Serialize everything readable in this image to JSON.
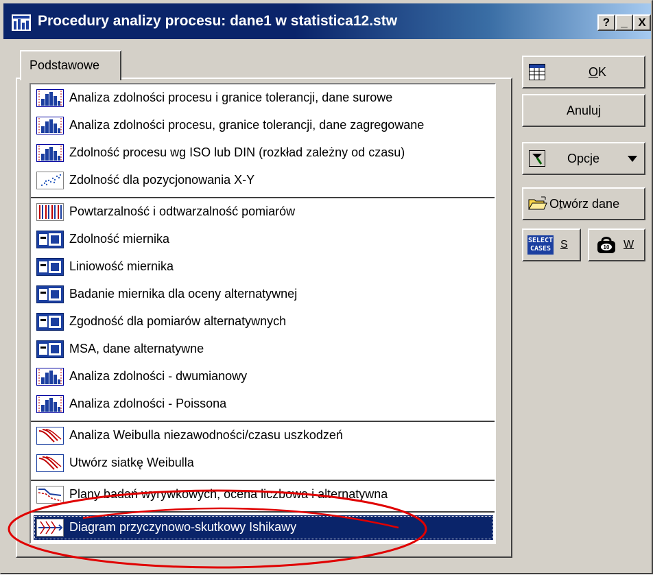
{
  "window": {
    "title": "Procedury analizy procesu: dane1 w statistica12.stw",
    "caption_buttons": [
      "?",
      "_",
      "X"
    ]
  },
  "tabs": [
    {
      "label": "Podstawowe",
      "active": true
    }
  ],
  "list": {
    "items": [
      {
        "label": "Analiza zdolności procesu i granice tolerancji, dane surowe",
        "icon": "capability-histogram-icon"
      },
      {
        "label": "Analiza zdolności procesu, granice tolerancji, dane zagregowane",
        "icon": "capability-histogram-icon"
      },
      {
        "label": "Zdolność procesu wg ISO lub DIN (rozkład zależny od czasu)",
        "icon": "capability-histogram-icon"
      },
      {
        "label": "Zdolność dla pozycjonowania X-Y",
        "icon": "scatter-icon"
      },
      {
        "label": "Powtarzalność i odtwarzalność pomiarów",
        "icon": "repeatability-icon"
      },
      {
        "label": "Zdolność miernika",
        "icon": "gauge-icon"
      },
      {
        "label": "Liniowość miernika",
        "icon": "gauge-icon"
      },
      {
        "label": "Badanie miernika dla oceny alternatywnej",
        "icon": "gauge-icon"
      },
      {
        "label": "Zgodność dla pomiarów alternatywnych",
        "icon": "gauge-icon"
      },
      {
        "label": "MSA, dane alternatywne",
        "icon": "gauge-icon"
      },
      {
        "label": "Analiza zdolności - dwumianowy",
        "icon": "capability-histogram-icon"
      },
      {
        "label": "Analiza zdolności - Poissona",
        "icon": "capability-histogram-icon"
      },
      {
        "label": "Analiza Weibulla niezawodności/czasu uszkodzeń",
        "icon": "weibull-icon"
      },
      {
        "label": "Utwórz siatkę Weibulla",
        "icon": "weibull-icon"
      },
      {
        "label": "Plany badań wyrywkowych, ocena liczbowa i alternatywna",
        "icon": "sampling-plan-icon"
      },
      {
        "label": "Diagram przyczynowo-skutkowy Ishikawy",
        "icon": "fishbone-icon",
        "selected": true
      }
    ]
  },
  "buttons": {
    "ok": {
      "prefix": "",
      "accel": "O",
      "rest": "K"
    },
    "cancel": "Anuluj",
    "options": {
      "accel": "",
      "label": "Opcje"
    },
    "open_data": {
      "pre": "O",
      "accel": "t",
      "rest": "wórz dane"
    },
    "select_cases": {
      "badge1": "SELECT",
      "badge2": "CASES",
      "label": "S"
    },
    "weight": {
      "label": "W"
    }
  },
  "colors": {
    "selection": "#0a246a",
    "annotation": "#e00000",
    "face": "#d4d0c8"
  }
}
